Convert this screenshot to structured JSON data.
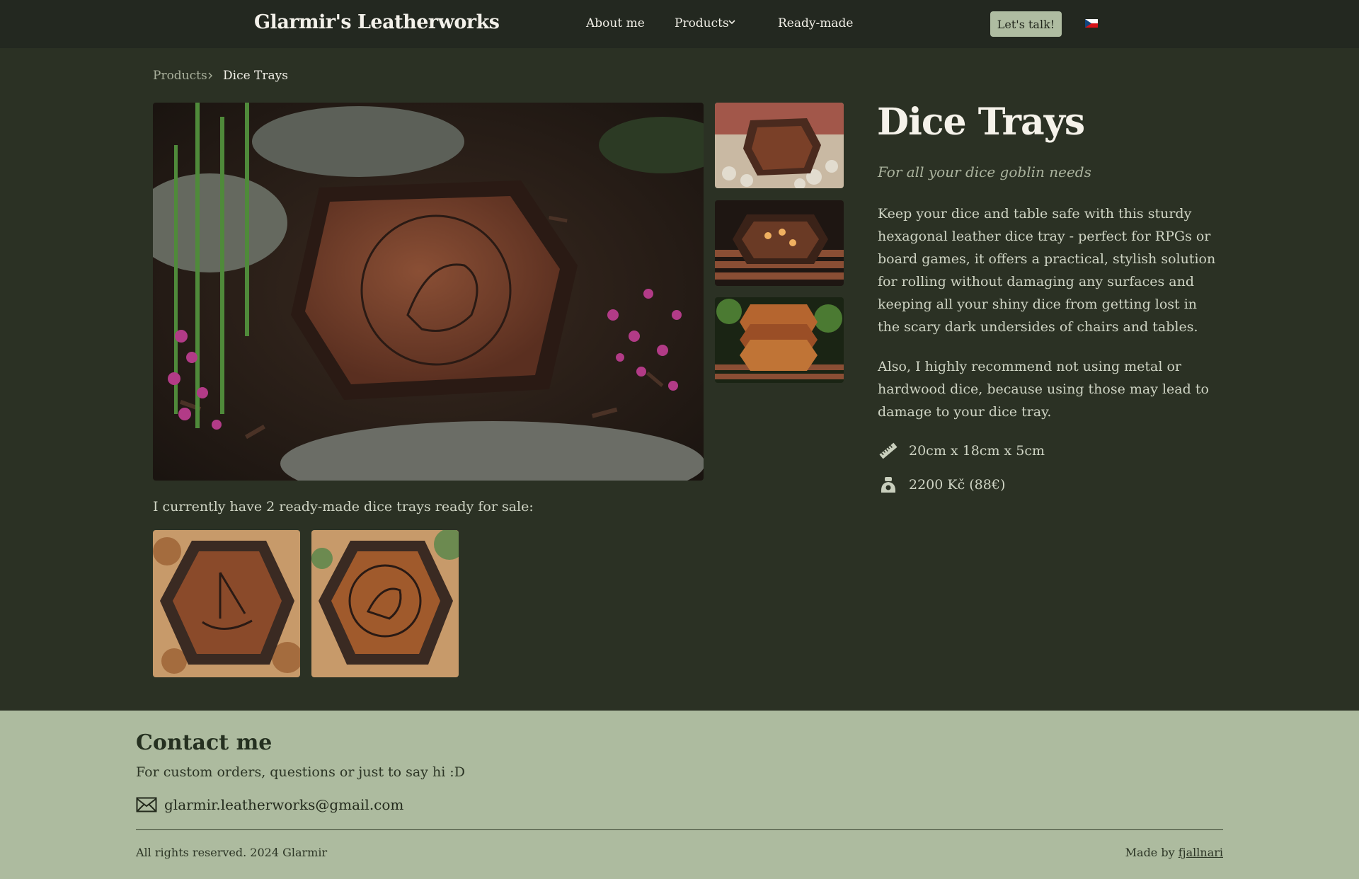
{
  "header": {
    "brand": "Glarmir's Leatherworks",
    "nav": {
      "about": "About me",
      "products": "Products",
      "ready_made": "Ready-made"
    },
    "cta": "Let's talk!",
    "language_flag": "czech-flag"
  },
  "breadcrumb": {
    "parent": "Products",
    "current": "Dice Trays"
  },
  "product": {
    "title": "Dice Trays",
    "tagline": "For all your dice goblin needs",
    "description_1": "Keep your dice and table safe with this sturdy hexagonal leather dice tray - perfect for RPGs or board games, it offers a practical, stylish solution for rolling without damaging any surfaces and keeping all your shiny dice from getting lost in the scary dark undersides of chairs and tables.",
    "description_2": "Also, I highly recommend not using metal or hardwood dice, because using those may lead to damage to your dice tray.",
    "dimensions": "20cm x 18cm x 5cm",
    "price": "2200 Kč (88€)"
  },
  "ready_made": {
    "text": "I currently have 2 ready-made dice trays ready for sale:"
  },
  "footer": {
    "contact_title": "Contact me",
    "contact_sub": "For custom orders, questions or just to say hi :D",
    "email": "glarmir.leatherworks@gmail.com",
    "rights": "All rights reserved. 2024 Glarmir",
    "made_by_prefix": "Made by",
    "made_by_link": "fjallnari"
  },
  "colors": {
    "background": "#2b3124",
    "header": "#232820",
    "accent": "#afbca1",
    "footer": "#adbb9f"
  }
}
